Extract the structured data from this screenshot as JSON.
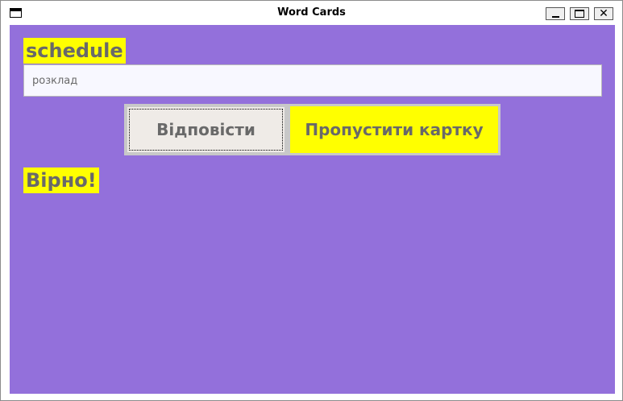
{
  "window": {
    "title": "Word Cards",
    "minimize_icon": "minimize-icon",
    "maximize_icon": "maximize-icon",
    "close_icon": "close-icon"
  },
  "card": {
    "word": "schedule",
    "answer_value": "розклад",
    "answer_placeholder": ""
  },
  "buttons": {
    "answer_label": "Відповісти",
    "skip_label": "Пропустити картку"
  },
  "result": {
    "text": "Вірно!"
  },
  "colors": {
    "background": "#9370db",
    "highlight": "#ffff00",
    "text": "#696969",
    "input_background": "#f8f8ff",
    "button_background": "#efebe7"
  }
}
